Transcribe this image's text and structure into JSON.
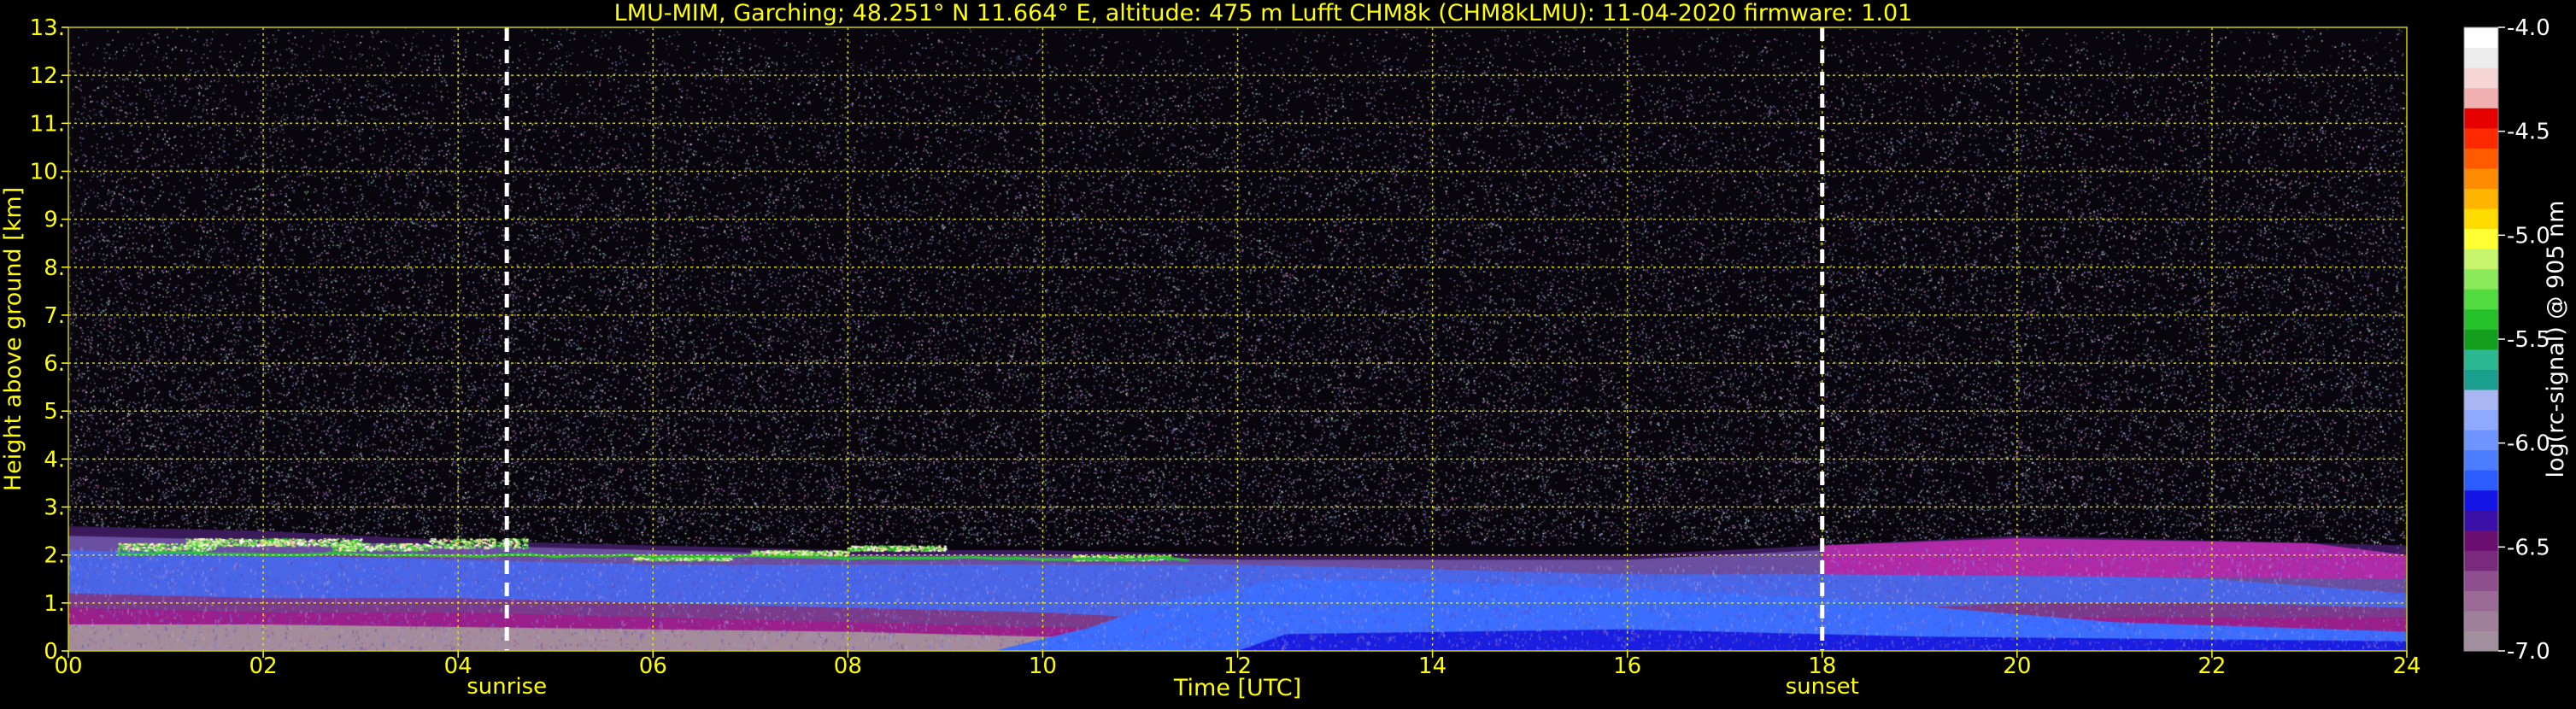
{
  "chart_data": {
    "type": "heatmap",
    "title": "LMU-MIM, Garching; 48.251° N 11.664° E, altitude: 475 m    Lufft CHM8k (CHM8kLMU): 11-04-2020    firmware: 1.01",
    "xlabel": "Time [UTC]",
    "ylabel": "Height above ground [km]",
    "xlim": [
      0,
      24
    ],
    "ylim": [
      0,
      13
    ],
    "x_ticks": [
      0,
      2,
      4,
      6,
      8,
      10,
      12,
      14,
      16,
      18,
      20,
      22,
      24
    ],
    "x_tick_labels": [
      "00",
      "02",
      "04",
      "06",
      "08",
      "10",
      "12",
      "14",
      "16",
      "18",
      "20",
      "22",
      "24"
    ],
    "y_ticks": [
      0,
      1,
      2,
      3,
      4,
      5,
      6,
      7,
      8,
      9,
      10,
      11,
      12,
      13
    ],
    "y_tick_labels": [
      "0.",
      "1.",
      "2.",
      "3.",
      "4.",
      "5.",
      "6.",
      "7.",
      "8.",
      "9.",
      "10.",
      "11.",
      "12.",
      "13."
    ],
    "grid": true,
    "events": [
      {
        "label": "sunrise",
        "time": 4.5
      },
      {
        "label": "sunset",
        "time": 18.0
      }
    ],
    "colorbar": {
      "label": "log(rc-signal) @ 905 nm",
      "range": [
        -7.0,
        -4.0
      ],
      "ticks": [
        -7.0,
        -6.5,
        -6.0,
        -5.5,
        -5.0,
        -4.5,
        -4.0
      ],
      "tick_labels": [
        "-7.0",
        "-6.5",
        "-6.0",
        "-5.5",
        "-5.0",
        "-4.5",
        "-4.0"
      ],
      "colors": [
        "#a3909f",
        "#a07f9b",
        "#9b6a97",
        "#8e4f8e",
        "#7a2a7d",
        "#6a0f70",
        "#3a10a8",
        "#1414e6",
        "#2a5cff",
        "#4d7dff",
        "#6e95ff",
        "#8fa9ff",
        "#a9b6f2",
        "#1a9f8f",
        "#2ab890",
        "#149e1e",
        "#26c02a",
        "#52dc40",
        "#8ceb5a",
        "#c8f56e",
        "#ffff33",
        "#ffdc00",
        "#ffb400",
        "#ff8c00",
        "#ff5a00",
        "#ff2a00",
        "#e60000",
        "#f0b0b0",
        "#f5d5d5",
        "#ececec",
        "#ffffff"
      ]
    },
    "colors": {
      "text": "#ffff00",
      "grid": "#e8e800",
      "event_line": "#ffffff",
      "background": "#000000"
    }
  }
}
